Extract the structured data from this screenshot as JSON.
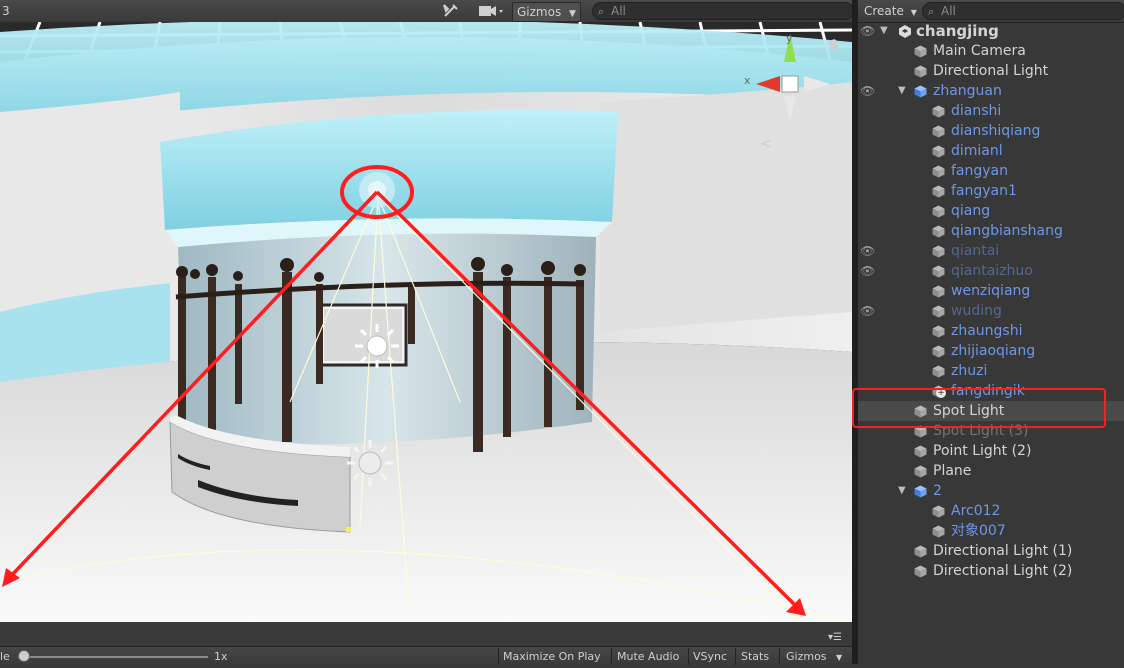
{
  "scene": {
    "toolbar": {
      "left_fragment": "3",
      "gizmos_label": "Gizmos",
      "search_placeholder": "All"
    },
    "axis_gizmo": {
      "x_label": "x",
      "y_label": "y",
      "mode_symbol": "<"
    },
    "bottom_toolbar": {
      "scale_label": "le",
      "scale_value": "1x",
      "scale_level": 0.0,
      "maximize_on_play": "Maximize On Play",
      "mute_audio": "Mute Audio",
      "vsync": "VSync",
      "stats": "Stats",
      "gizmos": "Gizmos"
    }
  },
  "hierarchy": {
    "create_label": "Create",
    "search_placeholder": "All",
    "scene_name": "changjing",
    "items": [
      {
        "label": "Main Camera",
        "style": "default",
        "icon": "cube-icon"
      },
      {
        "label": "Directional Light",
        "style": "default",
        "icon": "cube-icon"
      },
      {
        "label": "zhanguan",
        "style": "prefab",
        "icon": "prefab-icon"
      },
      {
        "label": "dianshi",
        "style": "prefab",
        "icon": "cube-icon"
      },
      {
        "label": "dianshiqiang",
        "style": "prefab",
        "icon": "cube-icon"
      },
      {
        "label": "dimianl",
        "style": "prefab",
        "icon": "cube-icon"
      },
      {
        "label": "fangyan",
        "style": "prefab",
        "icon": "cube-icon"
      },
      {
        "label": "fangyan1",
        "style": "prefab",
        "icon": "cube-icon"
      },
      {
        "label": "qiang",
        "style": "prefab",
        "icon": "cube-icon"
      },
      {
        "label": "qiangbianshang",
        "style": "prefab",
        "icon": "cube-icon"
      },
      {
        "label": "qiantai",
        "style": "disabled-prefab",
        "icon": "cube-icon"
      },
      {
        "label": "qiantaizhuo",
        "style": "disabled-prefab",
        "icon": "cube-icon"
      },
      {
        "label": "wenziqiang",
        "style": "prefab",
        "icon": "cube-icon"
      },
      {
        "label": "wuding",
        "style": "disabled-prefab",
        "icon": "cube-icon"
      },
      {
        "label": "zhaungshi",
        "style": "prefab",
        "icon": "cube-icon"
      },
      {
        "label": "zhijiaoqiang",
        "style": "prefab",
        "icon": "cube-icon"
      },
      {
        "label": "zhuzi",
        "style": "prefab",
        "icon": "cube-icon"
      },
      {
        "label": "fangdingik",
        "style": "prefab",
        "icon": "cube-icon"
      },
      {
        "label": "Spot Light",
        "style": "default",
        "icon": "cube-icon"
      },
      {
        "label": "Spot Light (3)",
        "style": "disabled",
        "icon": "cube-icon"
      },
      {
        "label": "Point Light (2)",
        "style": "default",
        "icon": "cube-icon"
      },
      {
        "label": "Plane",
        "style": "default",
        "icon": "cube-icon"
      },
      {
        "label": "2",
        "style": "prefab",
        "icon": "prefab-icon"
      },
      {
        "label": "Arc012",
        "style": "prefab",
        "icon": "cube-icon"
      },
      {
        "label": "对象007",
        "style": "prefab",
        "icon": "cube-icon"
      },
      {
        "label": "Directional Light (1)",
        "style": "default",
        "icon": "cube-icon"
      },
      {
        "label": "Directional Light (2)",
        "style": "default",
        "icon": "cube-icon"
      }
    ]
  }
}
